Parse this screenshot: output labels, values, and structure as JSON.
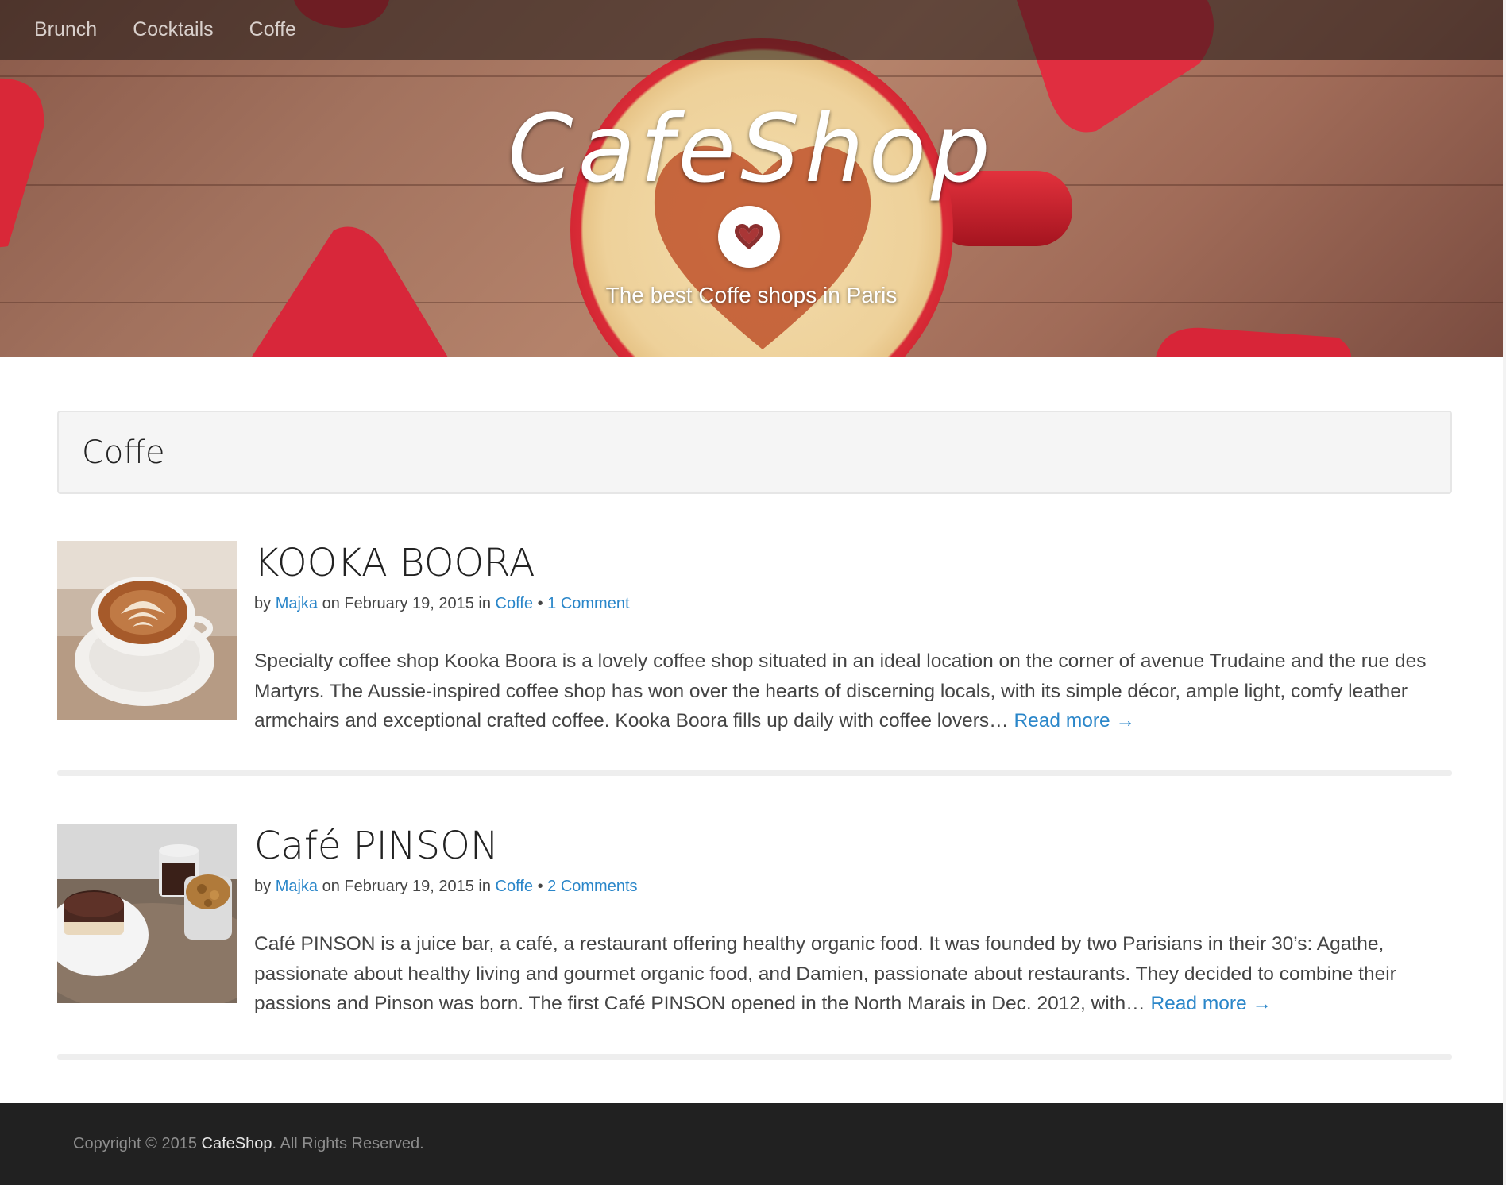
{
  "nav": {
    "items": [
      {
        "label": "Brunch"
      },
      {
        "label": "Cocktails"
      },
      {
        "label": "Coffe"
      }
    ]
  },
  "hero": {
    "brand": "CafeShop",
    "tagline": "The best Coffe shops in Paris",
    "badge_icon": "heart-icon"
  },
  "category": {
    "title": "Coffe"
  },
  "posts": [
    {
      "title": "KOOKA BOORA",
      "by": "by",
      "author": "Majka",
      "on": "on February 19, 2015 in",
      "category": "Coffe",
      "separator": "•",
      "comments": "1 Comment",
      "excerpt": "Specialty coffee shop   Kooka Boora is a lovely coffee shop situated in an ideal location on the corner of avenue Trudaine and the rue des Martyrs. The Aussie-inspired coffee shop has won over the hearts of discerning locals, with its simple décor, ample light, comfy leather armchairs and exceptional crafted coffee. Kooka Boora fills up daily with coffee lovers…",
      "read_more": "Read more →"
    },
    {
      "title": "Café PINSON",
      "by": "by",
      "author": "Majka",
      "on": "on February 19, 2015 in",
      "category": "Coffe",
      "separator": "•",
      "comments": "2 Comments",
      "excerpt": "Café PINSON is a juice bar, a café, a restaurant offering healthy organic food. It was founded by two Parisians in their 30’s: Agathe, passionate about healthy living and gourmet organic food, and Damien, passionate about restaurants. They decided to combine their passions and Pinson was born. The first Café PINSON opened in the North Marais in Dec. 2012, with…",
      "read_more": "Read more →"
    }
  ],
  "footer": {
    "prefix": "Copyright © 2015",
    "brand": "CafeShop",
    "suffix": ". All Rights Reserved."
  },
  "colors": {
    "link": "#2a86c9",
    "footer_bg": "#212121",
    "category_bg": "#f5f5f5",
    "cup_red": "#d92b37"
  }
}
